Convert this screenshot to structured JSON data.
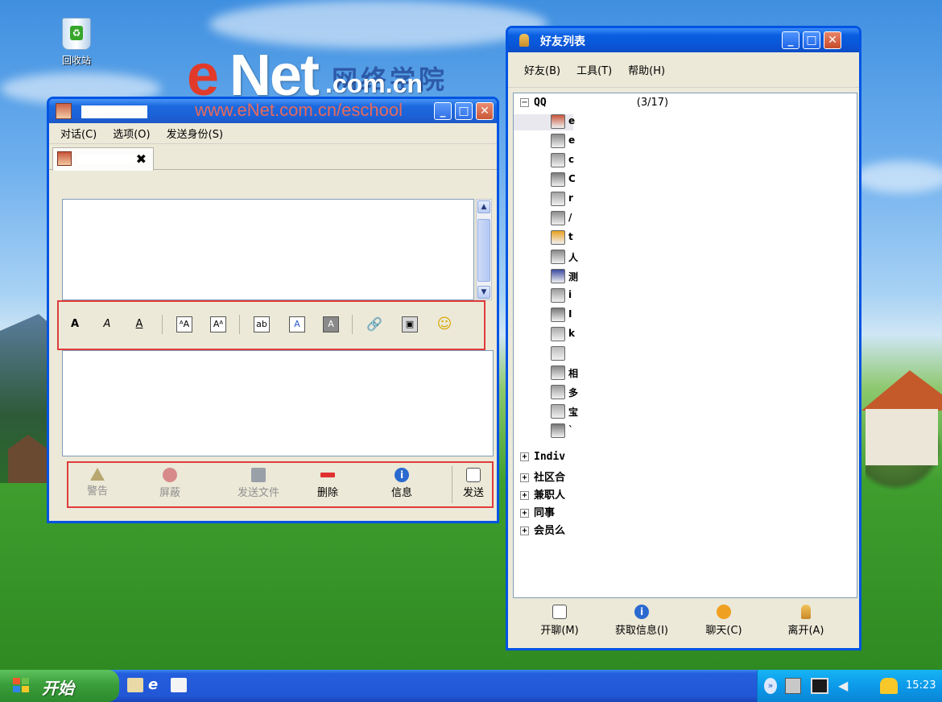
{
  "desktop": {
    "recycle_bin_label": "回收站",
    "watermark": {
      "e": "e",
      "net": "Net",
      "school": "网络学院",
      "com": ".com.cn",
      "url": "www.eNet.com.cn/eschool"
    }
  },
  "chat_window": {
    "menu": [
      "对话(C)",
      "选项(O)",
      "发送身份(S)"
    ],
    "tab_close": "✖",
    "format_toolbar": [
      "bold",
      "italic",
      "underline",
      "grow-font",
      "shrink-font",
      "font-face",
      "foreground-color",
      "background-color",
      "link",
      "image",
      "smiley"
    ],
    "format_glyphs": {
      "bold": "A",
      "italic": "A",
      "underline": "A"
    },
    "actions": [
      "警告",
      "屏蔽",
      "发送文件",
      "删除",
      "信息",
      "发送"
    ]
  },
  "buddy_window": {
    "title": "好友列表",
    "menu": [
      "好友(B)",
      "工具(T)",
      "帮助(H)"
    ],
    "groups": {
      "main": {
        "name": "QQ",
        "count": "(3/17)"
      },
      "others": [
        "Indiv",
        "社区合",
        "兼职人",
        "同事",
        "会员么"
      ]
    },
    "buddy_initials": [
      "e",
      "e",
      "c",
      "C",
      "r",
      "/",
      "t",
      "人",
      "测",
      "i",
      "I",
      "k",
      "",
      "相",
      "多",
      "宝",
      "`"
    ],
    "actions": [
      "开聊(M)",
      "获取信息(I)",
      "聊天(C)",
      "离开(A)"
    ]
  },
  "taskbar": {
    "start_label": "开始",
    "clock": "15:23"
  },
  "colors": {
    "xp_blue": "#0054e3",
    "start_green": "#3a9e3a",
    "highlight_red": "#e03c3c"
  }
}
